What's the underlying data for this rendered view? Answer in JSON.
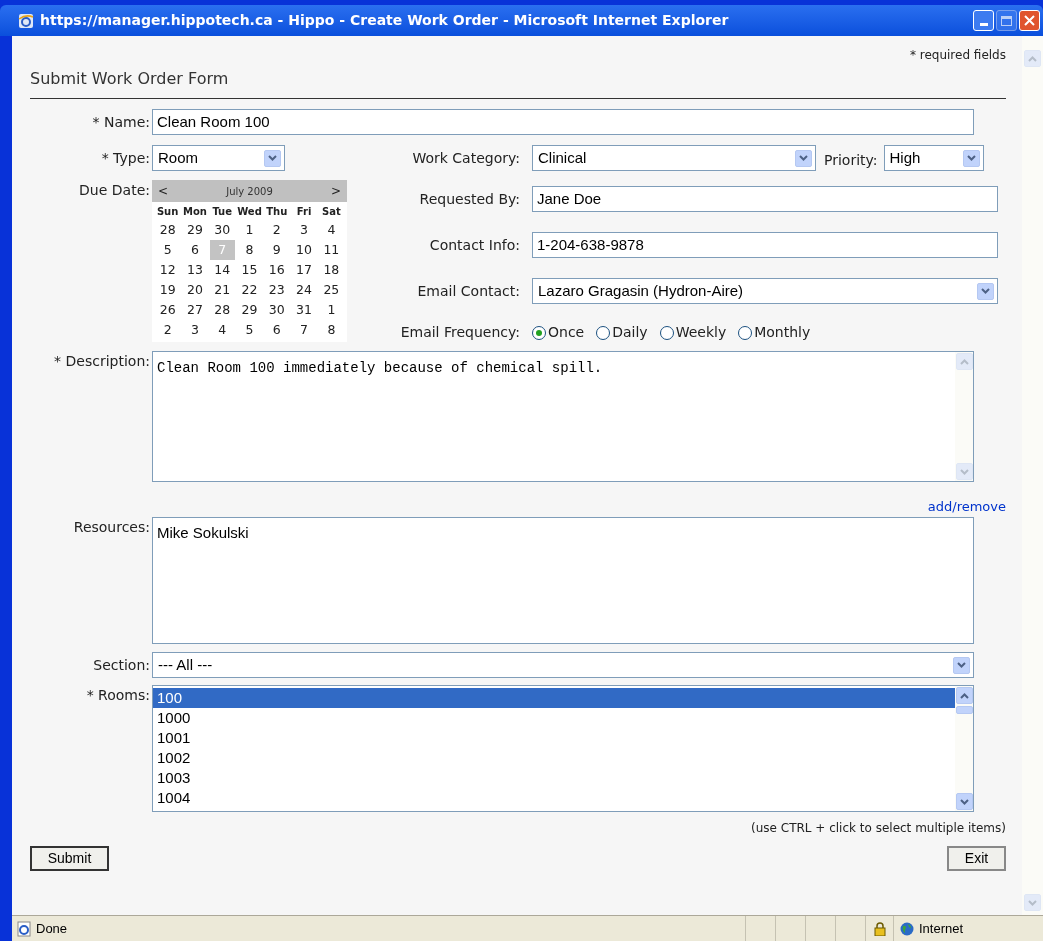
{
  "window": {
    "title": "https://manager.hippotech.ca - Hippo - Create Work Order - Microsoft Internet Explorer"
  },
  "required_note": "* required fields",
  "form_title": "Submit Work Order Form",
  "name": {
    "label": "* Name:",
    "value": "Clean Room 100"
  },
  "type": {
    "label": "* Type:",
    "value": "Room"
  },
  "due_date": {
    "label": "Due Date:",
    "calendar": {
      "prev": "<",
      "month": "July 2009",
      "next": ">",
      "weekdays": [
        "Sun",
        "Mon",
        "Tue",
        "Wed",
        "Thu",
        "Fri",
        "Sat"
      ],
      "days": [
        {
          "label": "28",
          "selected": false
        },
        {
          "label": "29",
          "selected": false
        },
        {
          "label": "30",
          "selected": false
        },
        {
          "label": "1",
          "selected": false
        },
        {
          "label": "2",
          "selected": false
        },
        {
          "label": "3",
          "selected": false
        },
        {
          "label": "4",
          "selected": false
        },
        {
          "label": "5",
          "selected": false
        },
        {
          "label": "6",
          "selected": false
        },
        {
          "label": "7",
          "selected": true
        },
        {
          "label": "8",
          "selected": false
        },
        {
          "label": "9",
          "selected": false
        },
        {
          "label": "10",
          "selected": false
        },
        {
          "label": "11",
          "selected": false
        },
        {
          "label": "12",
          "selected": false
        },
        {
          "label": "13",
          "selected": false
        },
        {
          "label": "14",
          "selected": false
        },
        {
          "label": "15",
          "selected": false
        },
        {
          "label": "16",
          "selected": false
        },
        {
          "label": "17",
          "selected": false
        },
        {
          "label": "18",
          "selected": false
        },
        {
          "label": "19",
          "selected": false
        },
        {
          "label": "20",
          "selected": false
        },
        {
          "label": "21",
          "selected": false
        },
        {
          "label": "22",
          "selected": false
        },
        {
          "label": "23",
          "selected": false
        },
        {
          "label": "24",
          "selected": false
        },
        {
          "label": "25",
          "selected": false
        },
        {
          "label": "26",
          "selected": false
        },
        {
          "label": "27",
          "selected": false
        },
        {
          "label": "28",
          "selected": false
        },
        {
          "label": "29",
          "selected": false
        },
        {
          "label": "30",
          "selected": false
        },
        {
          "label": "31",
          "selected": false
        },
        {
          "label": "1",
          "selected": false
        },
        {
          "label": "2",
          "selected": false
        },
        {
          "label": "3",
          "selected": false
        },
        {
          "label": "4",
          "selected": false
        },
        {
          "label": "5",
          "selected": false
        },
        {
          "label": "6",
          "selected": false
        },
        {
          "label": "7",
          "selected": false
        },
        {
          "label": "8",
          "selected": false
        }
      ]
    }
  },
  "work_category": {
    "label": "Work Category:",
    "value": "Clinical"
  },
  "priority": {
    "label": "Priority:",
    "value": "High"
  },
  "requested_by": {
    "label": "Requested By:",
    "value": "Jane Doe"
  },
  "contact_info": {
    "label": "Contact Info:",
    "value": "1-204-638-9878"
  },
  "email_contact": {
    "label": "Email Contact:",
    "value": "Lazaro Gragasin (Hydron-Aire)"
  },
  "email_frequency": {
    "label": "Email Frequency:",
    "options": [
      {
        "label": "Once",
        "selected": true
      },
      {
        "label": "Daily",
        "selected": false
      },
      {
        "label": "Weekly",
        "selected": false
      },
      {
        "label": "Monthly",
        "selected": false
      }
    ]
  },
  "description": {
    "label": "* Description:",
    "value": "Clean Room 100 immediately because of chemical spill."
  },
  "add_remove": "add/remove",
  "resources": {
    "label": "Resources:",
    "items": [
      "Mike Sokulski"
    ]
  },
  "section": {
    "label": "Section:",
    "value": "--- All ---"
  },
  "rooms": {
    "label": "* Rooms:",
    "items": [
      {
        "label": "100",
        "selected": true
      },
      {
        "label": "1000",
        "selected": false
      },
      {
        "label": "1001",
        "selected": false
      },
      {
        "label": "1002",
        "selected": false
      },
      {
        "label": "1003",
        "selected": false
      },
      {
        "label": "1004",
        "selected": false
      }
    ]
  },
  "hint": "(use CTRL + click to select multiple items)",
  "buttons": {
    "submit": "Submit",
    "exit": "Exit"
  },
  "status_bar": {
    "text": "Done",
    "zone": "Internet"
  }
}
